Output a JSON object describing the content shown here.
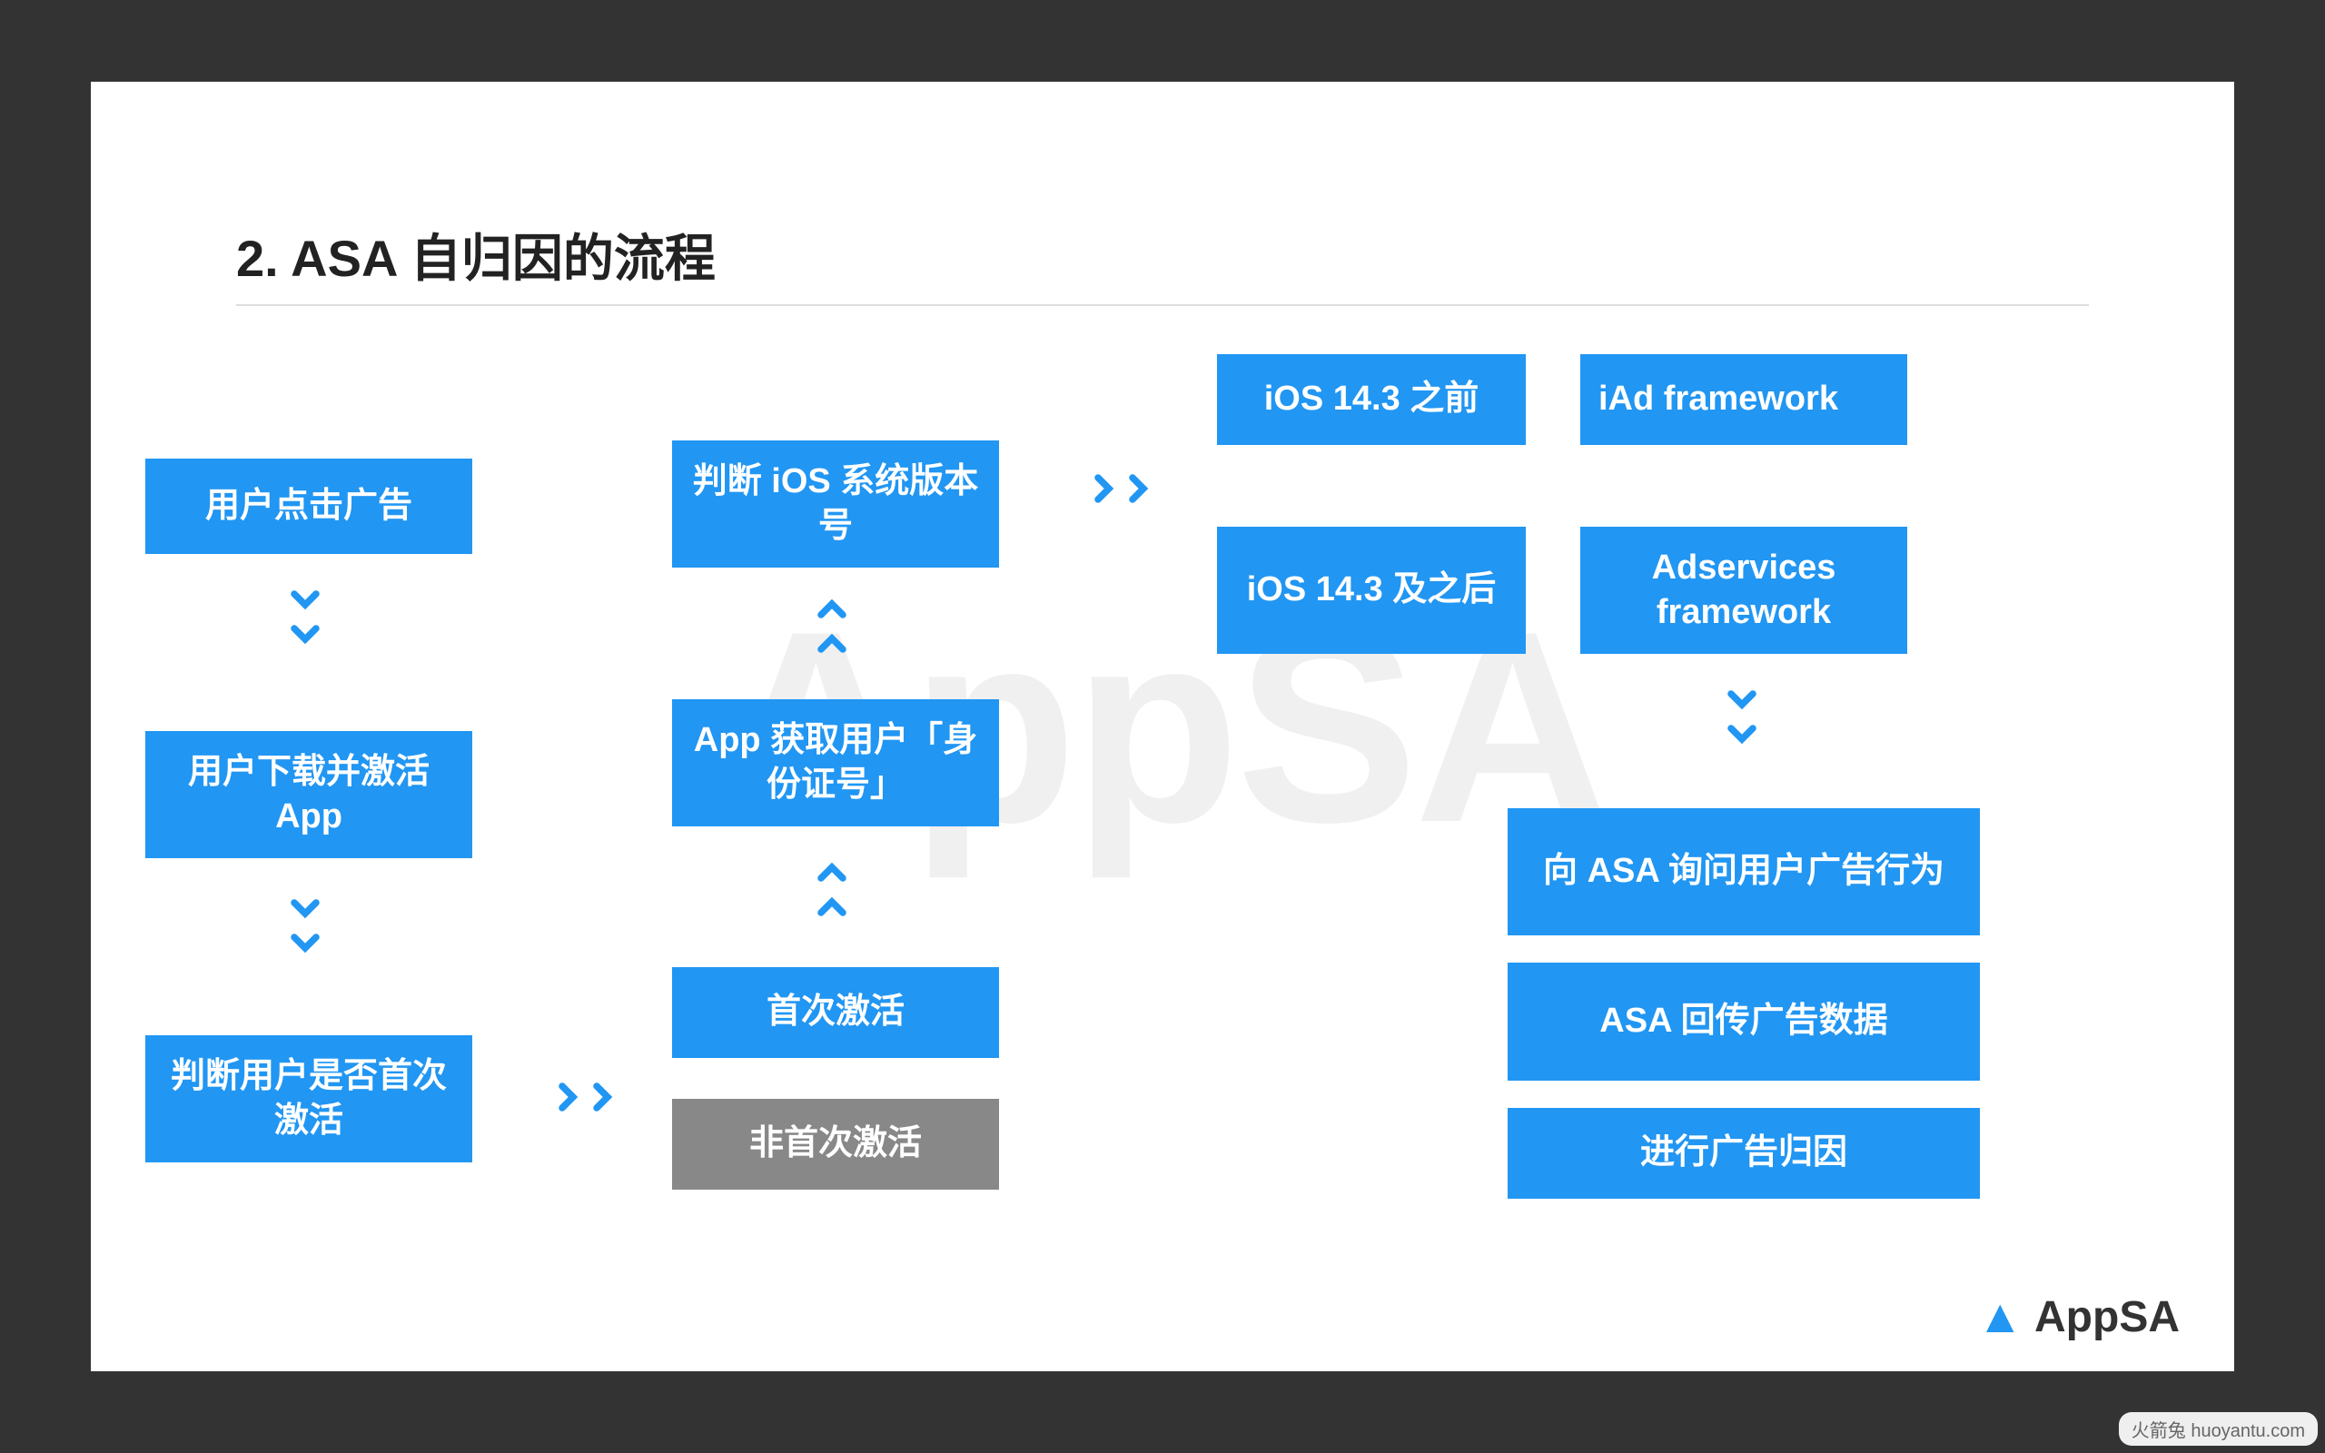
{
  "title": "2. ASA 自归因的流程",
  "watermark": "AppSA",
  "logo": {
    "text": "AppSA"
  },
  "source_badge": "火箭兔 huoyantu.com",
  "column1": {
    "b1": "用户点击广告",
    "b2": "用户下载并激活 App",
    "b3": "判断用户是否首次激活"
  },
  "column2": {
    "b1": "判断 iOS 系统版本号",
    "b2": "App 获取用户「身份证号」",
    "b3": "首次激活",
    "b4": "非首次激活"
  },
  "branch": {
    "top1": "iOS 14.3 之前",
    "top2": "iAd framework",
    "bot1": "iOS 14.3 及之后",
    "bot2": "Adservices framework"
  },
  "column3": {
    "b1": "向 ASA 询问用户广告行为",
    "b2": "ASA 回传广告数据",
    "b3": "进行广告归因"
  }
}
